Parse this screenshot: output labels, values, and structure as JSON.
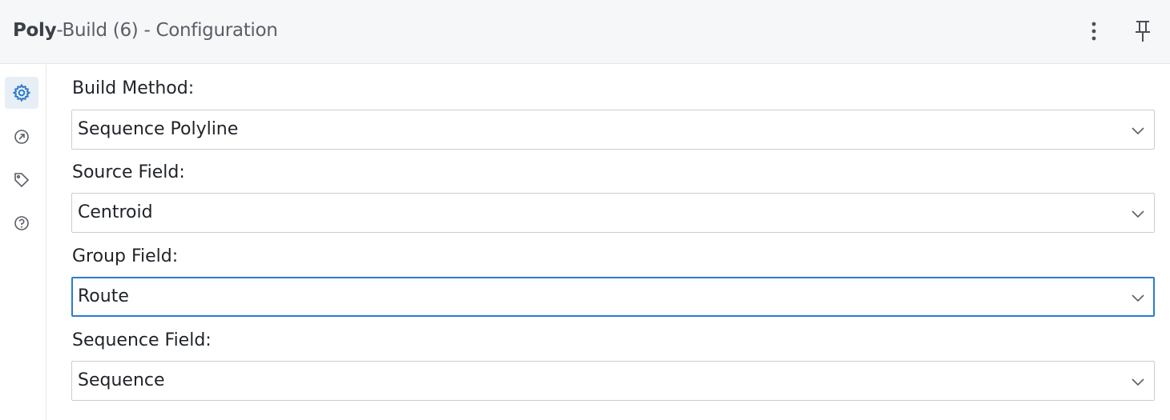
{
  "header": {
    "tool_name": "Poly",
    "title_rest": "-Build (6) - Configuration",
    "menu_icon": "kebab-menu-icon",
    "pin_icon": "pin-icon"
  },
  "side_rail": {
    "items": [
      {
        "icon": "gear-icon",
        "active": true
      },
      {
        "icon": "arrow-up-right-circle-icon",
        "active": false
      },
      {
        "icon": "tag-icon",
        "active": false
      },
      {
        "icon": "help-circle-icon",
        "active": false
      }
    ]
  },
  "form": {
    "build_method": {
      "label": "Build Method:",
      "value": "Sequence Polyline"
    },
    "source_field": {
      "label": "Source Field:",
      "value": "Centroid"
    },
    "group_field": {
      "label": "Group Field:",
      "value": "Route"
    },
    "sequence_field": {
      "label": "Sequence Field:",
      "value": "Sequence"
    }
  },
  "colors": {
    "accent": "#2b7bd0",
    "header_bg": "#f5f7f9",
    "border": "#c9ced4"
  }
}
